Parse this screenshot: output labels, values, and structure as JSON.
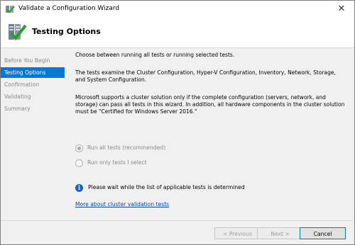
{
  "window": {
    "title": "Validate a Configuration Wizard",
    "close_glyph": "✕"
  },
  "header": {
    "heading": "Testing Options"
  },
  "steps": [
    {
      "label": "Before You Begin"
    },
    {
      "label": "Testing Options"
    },
    {
      "label": "Confirmation"
    },
    {
      "label": "Validating"
    },
    {
      "label": "Summary"
    }
  ],
  "content": {
    "intro": "Choose between running all tests or running selected tests.",
    "tests_examine": "The tests examine the Cluster Configuration, Hyper-V Configuration, Inventory, Network, Storage, and System Configuration.",
    "support_note": "Microsoft supports a cluster solution only if the complete configuration (servers, network, and storage) can pass all tests in this wizard. In addition, all hardware components in the cluster solution must be \"Certified for Windows Server 2016.\"",
    "options": [
      {
        "label": "Run all tests (recommended)",
        "selected": true
      },
      {
        "label": "Run only tests I select",
        "selected": false
      }
    ],
    "info_text": "Please wait while the list of applicable tests is determined",
    "info_glyph": "i",
    "link": "More about cluster validation tests"
  },
  "footer": {
    "previous": "< Previous",
    "next": "Next >",
    "cancel": "Cancel"
  },
  "colors": {
    "accent": "#0078d7",
    "link": "#0645ad"
  }
}
